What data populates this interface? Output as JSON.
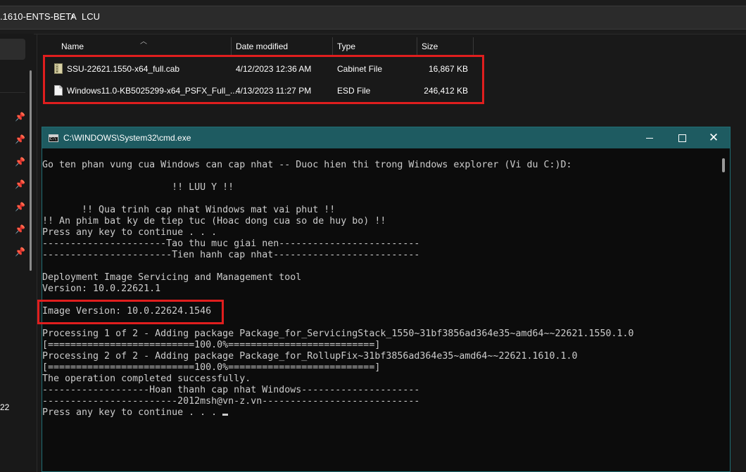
{
  "explorer": {
    "breadcrumb": {
      "segment1": ".1610-ENTS-BETA",
      "separator": "›",
      "segment2": "LCU"
    },
    "columns": {
      "name": "Name",
      "date": "Date modified",
      "type": "Type",
      "size": "Size"
    },
    "files": [
      {
        "name": "SSU-22621.1550-x64_full.cab",
        "date": "4/12/2023 12:36 AM",
        "type": "Cabinet File",
        "size": "16,867 KB",
        "icon": "cabinet-file-icon"
      },
      {
        "name": "Windows11.0-KB5025299-x64_PSFX_Full_...",
        "date": "4/13/2023 11:27 PM",
        "type": "ESD File",
        "size": "246,412 KB",
        "icon": "document-file-icon"
      }
    ],
    "nav_pane": {
      "partial_text": "22"
    }
  },
  "cmd": {
    "title": "C:\\WINDOWS\\System32\\cmd.exe",
    "icon_text": "C:\\",
    "controls": {
      "minimize": "",
      "maximize": "",
      "close": "✕"
    },
    "lines": [
      "Go ten phan vung cua Windows can cap nhat -- Duoc hien thi trong Windows explorer (Vi du C:)D:",
      "",
      "                       !! LUU Y !!",
      "",
      "       !! Qua trinh cap nhat Windows mat vai phut !!",
      "!! An phim bat ky de tiep tuc (Hoac dong cua so de huy bo) !!",
      "Press any key to continue . . .",
      "----------------------Tao thu muc giai nen-------------------------",
      "-----------------------Tien hanh cap nhat--------------------------",
      "",
      "Deployment Image Servicing and Management tool",
      "Version: 10.0.22621.1",
      "",
      "Image Version: 10.0.22624.1546",
      "",
      "Processing 1 of 2 - Adding package Package_for_ServicingStack_1550~31bf3856ad364e35~amd64~~22621.1550.1.0",
      "[==========================100.0%==========================]",
      "Processing 2 of 2 - Adding package Package_for_RollupFix~31bf3856ad364e35~amd64~~22621.1610.1.0",
      "[==========================100.0%==========================]",
      "The operation completed successfully.",
      "-------------------Hoan thanh cap nhat Windows---------------------",
      "------------------------2012msh@vn-z.vn----------------------------",
      "Press any key to continue . . . "
    ]
  },
  "colors": {
    "highlight_red": "#e01e1e",
    "cmd_titlebar": "#1e5b61",
    "cmd_text": "#cccccc",
    "explorer_bg": "#191919"
  }
}
